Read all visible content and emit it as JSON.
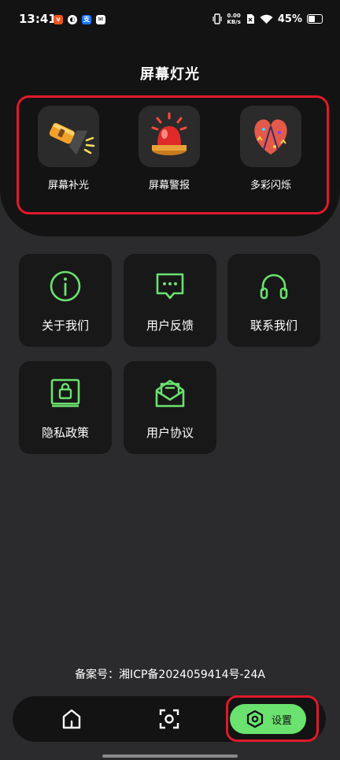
{
  "status_bar": {
    "time": "13:41",
    "net_speed_value": "0.00",
    "net_speed_unit": "KB/s",
    "battery_percent": "45%",
    "notification_icons": [
      "vivo-app-icon",
      "swirl-app-icon",
      "alipay-icon",
      "message-icon"
    ]
  },
  "header": {
    "title": "屏幕灯光"
  },
  "features": [
    {
      "label": "屏幕补光",
      "icon": "flashlight-icon"
    },
    {
      "label": "屏幕警报",
      "icon": "alarm-siren-icon"
    },
    {
      "label": "多彩闪烁",
      "icon": "party-heart-icon"
    }
  ],
  "menu": [
    {
      "label": "关于我们",
      "icon": "info-circle-icon"
    },
    {
      "label": "用户反馈",
      "icon": "feedback-bubble-icon"
    },
    {
      "label": "联系我们",
      "icon": "headset-icon"
    },
    {
      "label": "隐私政策",
      "icon": "privacy-lock-icon"
    },
    {
      "label": "用户协议",
      "icon": "agreement-envelope-icon"
    }
  ],
  "footer": {
    "icp": "备案号：湘ICP备2024059414号-24A"
  },
  "bottom_nav": {
    "items": [
      {
        "icon": "home-icon"
      },
      {
        "icon": "scan-icon"
      },
      {
        "icon": "settings-hex-icon",
        "label": "设置",
        "active": true
      }
    ]
  },
  "colors": {
    "accent_green": "#6be16f",
    "highlight_red": "#e0192a",
    "background": "#2b2b2d",
    "panel": "#131313",
    "card": "#181818"
  }
}
